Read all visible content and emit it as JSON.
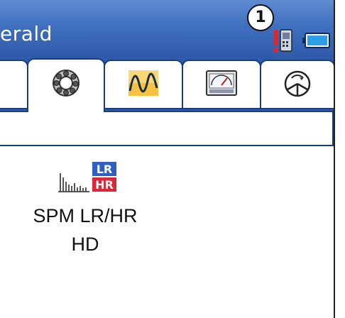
{
  "window": {
    "title": "erald"
  },
  "status": {
    "badge_number": "1",
    "icons": [
      "signal-warning-icon",
      "battery-icon"
    ]
  },
  "tabs": [
    {
      "name": "bearing-icon",
      "active": true
    },
    {
      "name": "waveform-icon",
      "active": false
    },
    {
      "name": "gauge-icon",
      "active": false
    },
    {
      "name": "speed-dial-icon",
      "active": false
    }
  ],
  "item": {
    "badge_top": "LR",
    "badge_bottom": "HR",
    "label_line1": "SPM LR/HR",
    "label_line2": "HD",
    "colors": {
      "lr": "#2f5fc0",
      "hr": "#d8283a"
    }
  },
  "colors": {
    "titlebar": "#3f6fbf",
    "border": "#1a3d80"
  }
}
